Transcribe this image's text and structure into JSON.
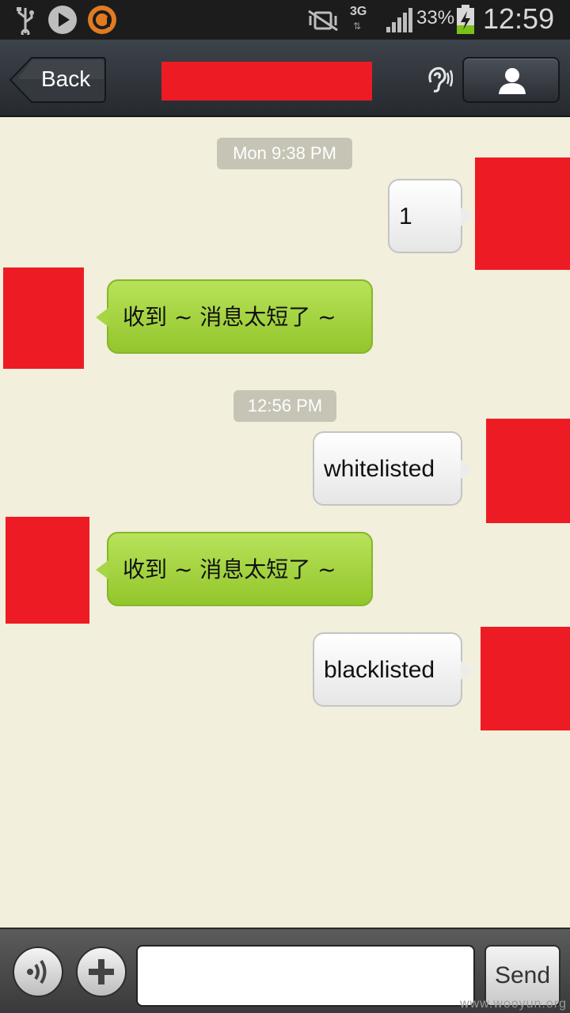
{
  "status_bar": {
    "network": "3G",
    "battery_percent": "33%",
    "time": "12:59"
  },
  "header": {
    "back_label": "Back",
    "title_redacted": true
  },
  "messages": [
    {
      "type": "timestamp",
      "text": "Mon 9:38 PM"
    },
    {
      "type": "outgoing",
      "text": "1"
    },
    {
      "type": "incoming",
      "text": "收到 ~ 消息太短了 ~"
    },
    {
      "type": "timestamp",
      "text": "12:56 PM"
    },
    {
      "type": "outgoing",
      "text": "whitelisted"
    },
    {
      "type": "incoming",
      "text": "收到 ~ 消息太短了 ~"
    },
    {
      "type": "outgoing",
      "text": "blacklisted"
    }
  ],
  "composer": {
    "input_value": "",
    "send_label": "Send"
  },
  "watermark": "www.wooyun.org",
  "colors": {
    "redaction": "#ed1c24",
    "incoming_bubble": "#a7d546",
    "chat_background": "#f2efdc"
  }
}
